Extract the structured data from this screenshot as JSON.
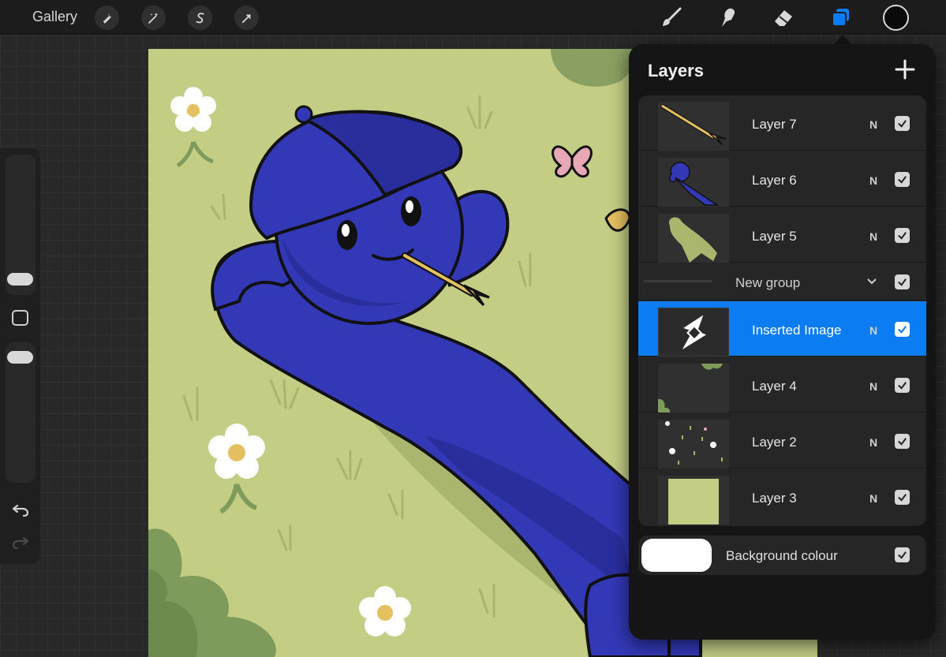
{
  "topbar": {
    "gallery_label": "Gallery",
    "left_tools": [
      "wrench-icon",
      "magic-wand-icon",
      "selection-icon",
      "transform-arrow-icon"
    ],
    "right_tools": [
      "brush-icon",
      "smudge-icon",
      "eraser-icon",
      "layers-icon"
    ],
    "active_color": "#0a0a0a",
    "accent": "#0b7cf2"
  },
  "layers_panel": {
    "title": "Layers",
    "layers": [
      {
        "name": "Layer 7",
        "blend": "N",
        "visible": true
      },
      {
        "name": "Layer 6",
        "blend": "N",
        "visible": true
      },
      {
        "name": "Layer 5",
        "blend": "N",
        "visible": true
      },
      {
        "name": "Inserted Image",
        "blend": "N",
        "visible": true,
        "selected": true
      },
      {
        "name": "Layer 4",
        "blend": "N",
        "visible": true
      },
      {
        "name": "Layer 2",
        "blend": "N",
        "visible": true
      },
      {
        "name": "Layer 3",
        "blend": "N",
        "visible": true
      }
    ],
    "group": {
      "name": "New group",
      "visible": true
    },
    "background": {
      "name": "Background colour",
      "color": "#ffffff",
      "visible": true
    }
  },
  "sidebar": {
    "icons": [
      "undo-icon",
      "redo-icon"
    ]
  }
}
